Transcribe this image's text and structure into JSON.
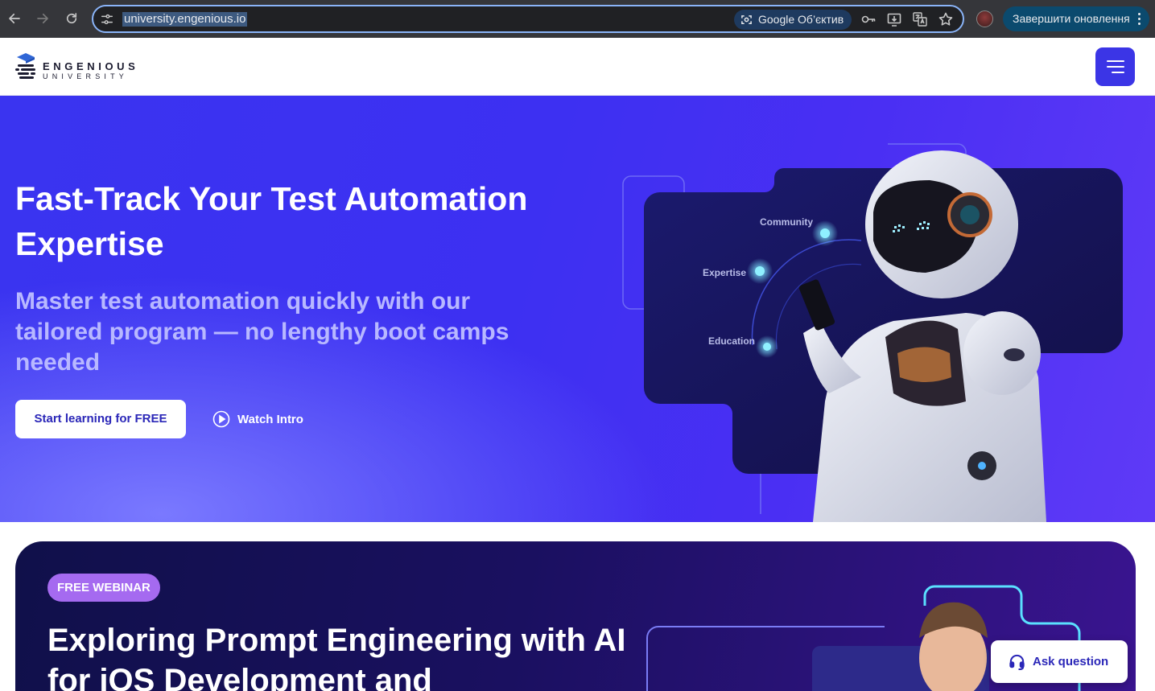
{
  "browser": {
    "url": "university.engenious.io",
    "lens_label": "Google Об’єктив",
    "update_button": "Завершити оновлення",
    "icons": [
      "back-icon",
      "forward-icon",
      "reload-icon",
      "site-settings-icon",
      "google-lens-icon",
      "password-key-icon",
      "install-app-icon",
      "translate-icon",
      "bookmark-star-icon",
      "profile-avatar",
      "more-menu-icon"
    ]
  },
  "header": {
    "logo_line1": "ENGENIOUS",
    "logo_line2": "UNIVERSITY",
    "menu_icon": "hamburger-menu-icon"
  },
  "hero": {
    "title": "Fast-Track Your Test Automation Expertise",
    "subtitle": "Master test automation quickly with our tailored program — no lengthy boot camps needed",
    "primary_cta": "Start learning for FREE",
    "secondary_cta": "Watch Intro",
    "art_labels": [
      "Community",
      "Expertise",
      "Education"
    ]
  },
  "webinar": {
    "badge": "FREE WEBINAR",
    "title": "Exploring Prompt Engineering with AI for iOS Development and"
  },
  "chat": {
    "ask_label": "Ask question"
  },
  "colors": {
    "brand_blue": "#3b35e6",
    "hero_bg": "#3d30f2",
    "subtitle": "#b8b8ff",
    "badge": "#a56af0",
    "chrome_bg": "#35363a"
  }
}
